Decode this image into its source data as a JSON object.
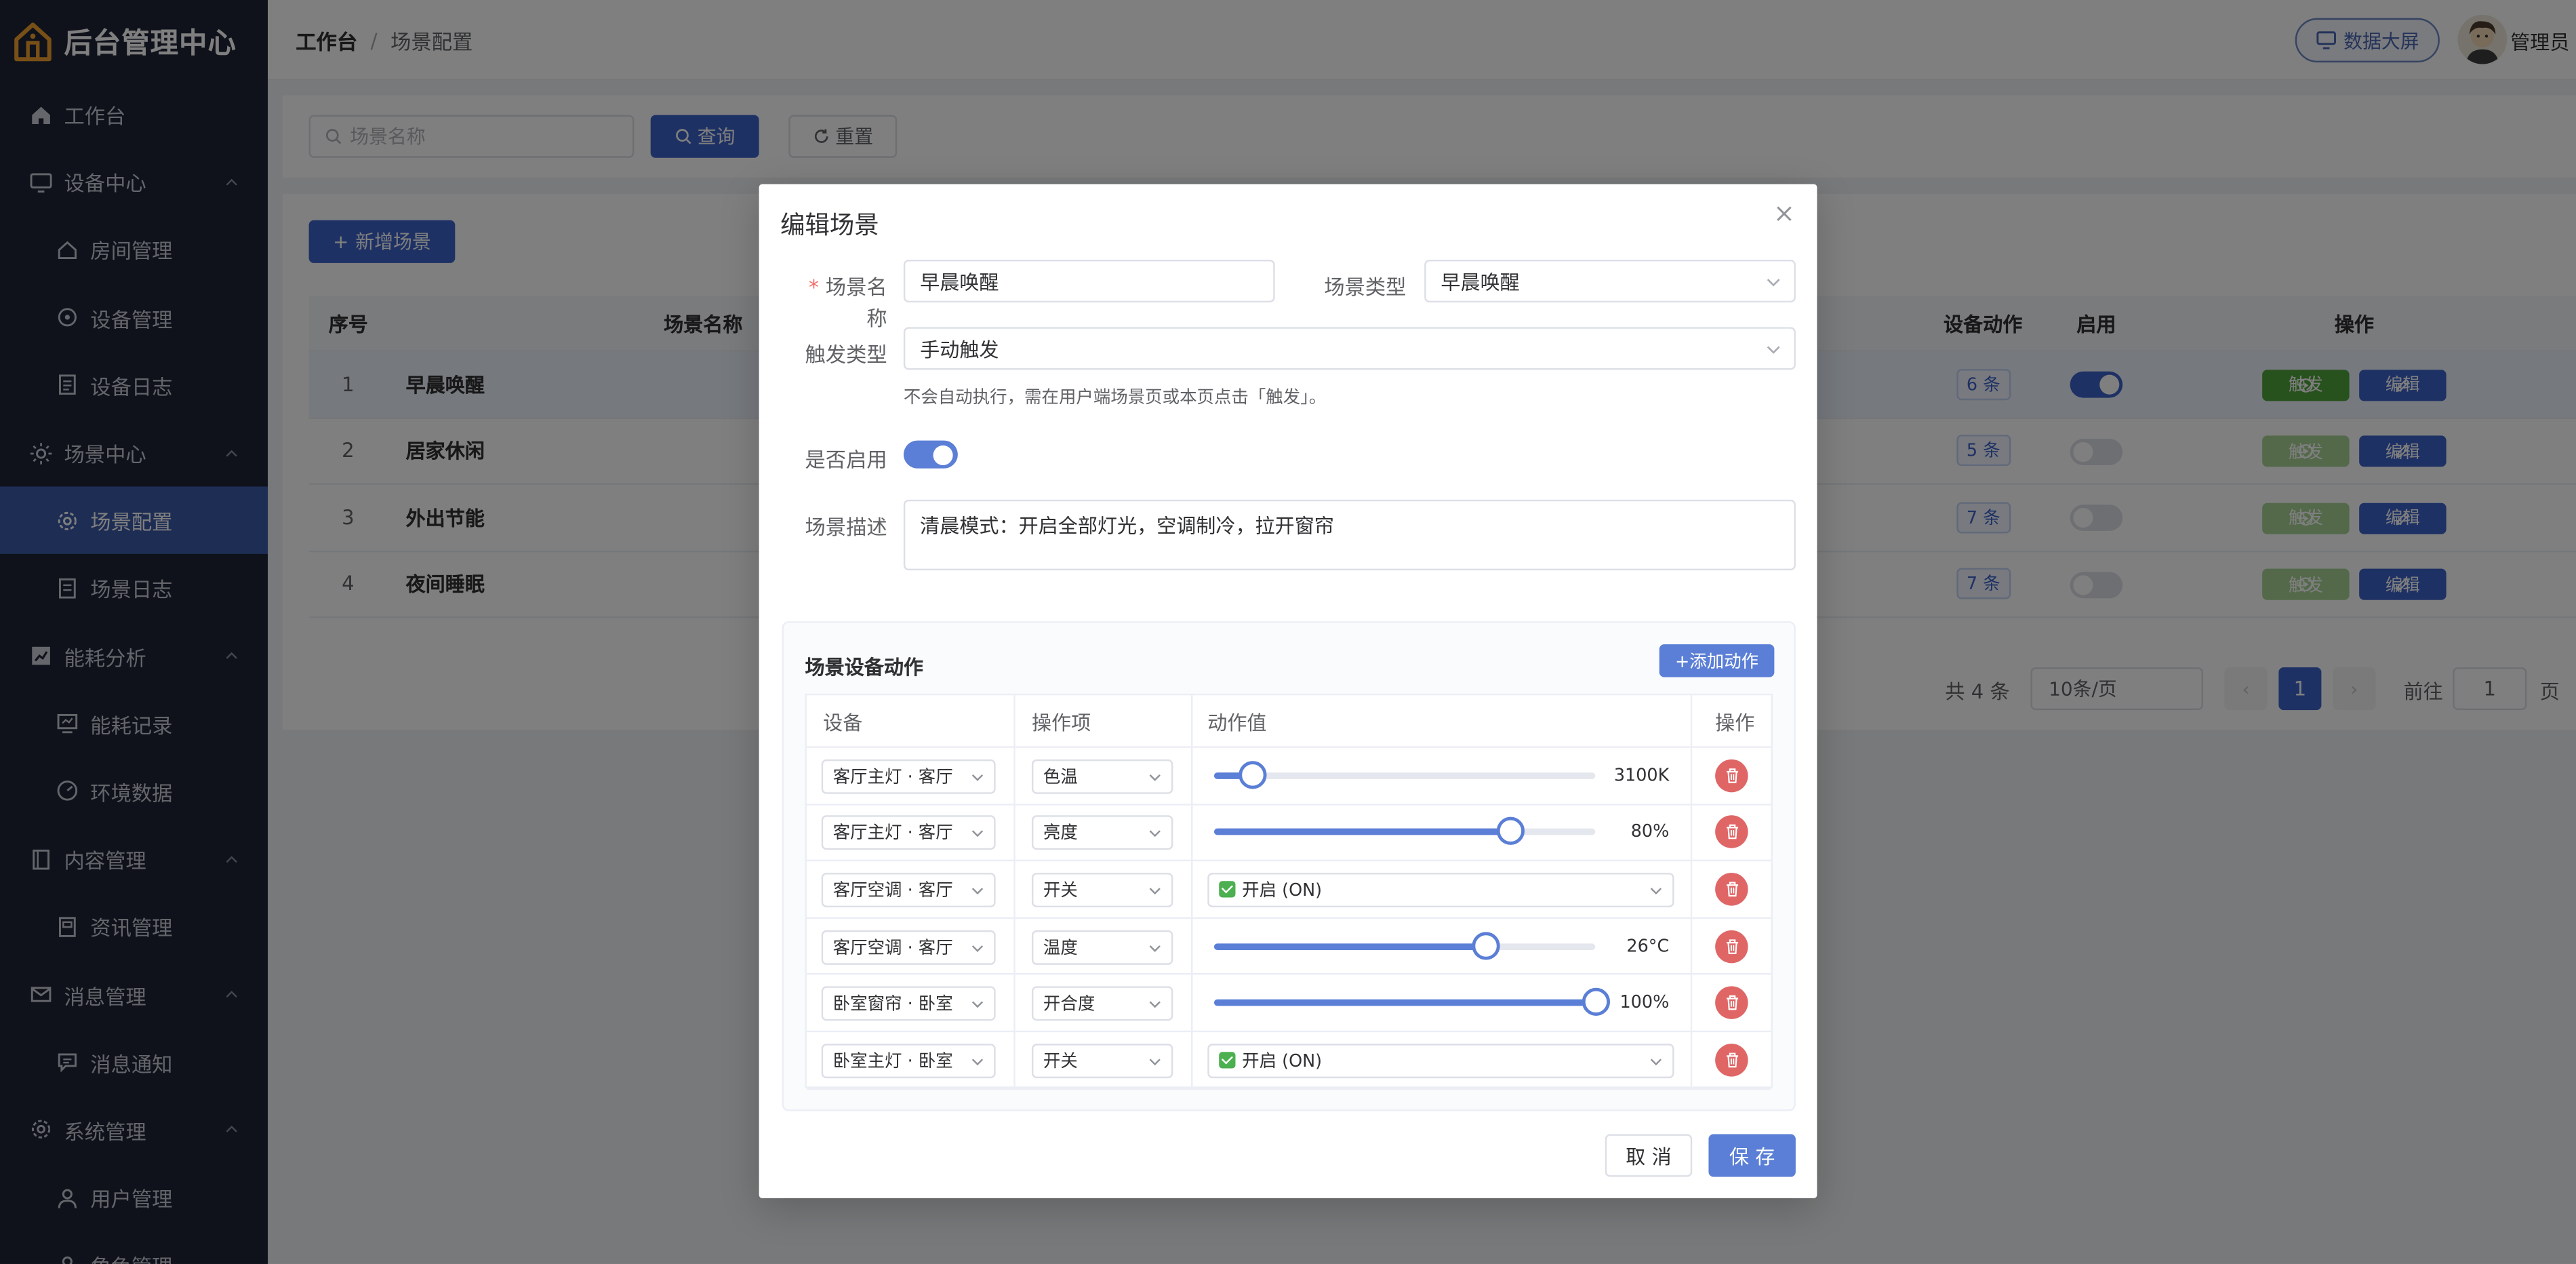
{
  "app": {
    "title": "后台管理中心"
  },
  "sidebar": {
    "items": [
      {
        "label": "工作台",
        "icon": "home-icon",
        "level": 0
      },
      {
        "label": "设备中心",
        "icon": "monitor-icon",
        "level": 0,
        "expanded": true
      },
      {
        "label": "房间管理",
        "icon": "house-icon",
        "level": 1
      },
      {
        "label": "设备管理",
        "icon": "devices-icon",
        "level": 1
      },
      {
        "label": "设备日志",
        "icon": "log-icon",
        "level": 1
      },
      {
        "label": "场景中心",
        "icon": "sun-icon",
        "level": 0,
        "expanded": true
      },
      {
        "label": "场景配置",
        "icon": "gear-icon",
        "level": 1,
        "active": true
      },
      {
        "label": "场景日志",
        "icon": "document-icon",
        "level": 1
      },
      {
        "label": "能耗分析",
        "icon": "chart-icon",
        "level": 0,
        "expanded": true
      },
      {
        "label": "能耗记录",
        "icon": "record-icon",
        "level": 1
      },
      {
        "label": "环境数据",
        "icon": "gauge-icon",
        "level": 1
      },
      {
        "label": "内容管理",
        "icon": "book-icon",
        "level": 0,
        "expanded": true
      },
      {
        "label": "资讯管理",
        "icon": "news-icon",
        "level": 1
      },
      {
        "label": "消息管理",
        "icon": "mail-icon",
        "level": 0,
        "expanded": true
      },
      {
        "label": "消息通知",
        "icon": "message-icon",
        "level": 1
      },
      {
        "label": "系统管理",
        "icon": "settings-icon",
        "level": 0,
        "expanded": true
      },
      {
        "label": "用户管理",
        "icon": "user-icon",
        "level": 1
      },
      {
        "label": "角色管理",
        "icon": "role-icon",
        "level": 1
      }
    ]
  },
  "header": {
    "breadcrumb_first": "工作台",
    "breadcrumb_sep": "/",
    "breadcrumb_last": "场景配置",
    "screen_button": "数据大屏",
    "user_name": "管理员"
  },
  "search": {
    "placeholder": "场景名称",
    "query_label": "查询",
    "reset_label": "重置"
  },
  "toolbar": {
    "add_label": "新增场景"
  },
  "table": {
    "headers": {
      "index": "序号",
      "name": "场景名称",
      "actions_count": "设备动作",
      "enabled": "启用",
      "ops": "操作"
    },
    "rows": [
      {
        "index": "1",
        "name": "早晨唤醒",
        "actions": "6 条",
        "enabled": true
      },
      {
        "index": "2",
        "name": "居家休闲",
        "actions": "5 条",
        "enabled": false
      },
      {
        "index": "3",
        "name": "外出节能",
        "actions": "7 条",
        "enabled": false
      },
      {
        "index": "4",
        "name": "夜间睡眠",
        "actions": "7 条",
        "enabled": false
      }
    ],
    "trigger_label": "触发",
    "edit_label": "编辑"
  },
  "pager": {
    "total": "共 4 条",
    "page_size": "10条/页",
    "current": "1",
    "goto_prefix": "前往",
    "goto_value": "1",
    "goto_suffix": "页"
  },
  "dialog": {
    "title": "编辑场景",
    "name_label": "场景名称",
    "name_value": "早晨唤醒",
    "type_label": "场景类型",
    "type_value": "早晨唤醒",
    "trigger_label": "触发类型",
    "trigger_value": "手动触发",
    "trigger_hint": "不会自动执行，需在用户端场景页或本页点击「触发」。",
    "enabled_label": "是否启用",
    "enabled": true,
    "desc_label": "场景描述",
    "desc_value": "清晨模式：开启全部灯光，空调制冷，拉开窗帘",
    "actions_title": "场景设备动作",
    "add_action_label": "+添加动作",
    "actions_headers": {
      "device": "设备",
      "op": "操作项",
      "value": "动作值",
      "ops": "操作"
    },
    "actions": [
      {
        "device": "客厅主灯 · 客厅",
        "op": "色温",
        "kind": "slider",
        "fraction": 0.1,
        "value": "3100K"
      },
      {
        "device": "客厅主灯 · 客厅",
        "op": "亮度",
        "kind": "slider",
        "fraction": 0.78,
        "value": "80%"
      },
      {
        "device": "客厅空调 · 客厅",
        "op": "开关",
        "kind": "select",
        "value": "开启 (ON)"
      },
      {
        "device": "客厅空调 · 客厅",
        "op": "温度",
        "kind": "slider",
        "fraction": 0.715,
        "value": "26°C"
      },
      {
        "device": "卧室窗帘 · 卧室",
        "op": "开合度",
        "kind": "slider",
        "fraction": 1.0,
        "value": "100%"
      },
      {
        "device": "卧室主灯 · 卧室",
        "op": "开关",
        "kind": "select",
        "value": "开启 (ON)"
      }
    ],
    "cancel_label": "取 消",
    "save_label": "保 存"
  }
}
